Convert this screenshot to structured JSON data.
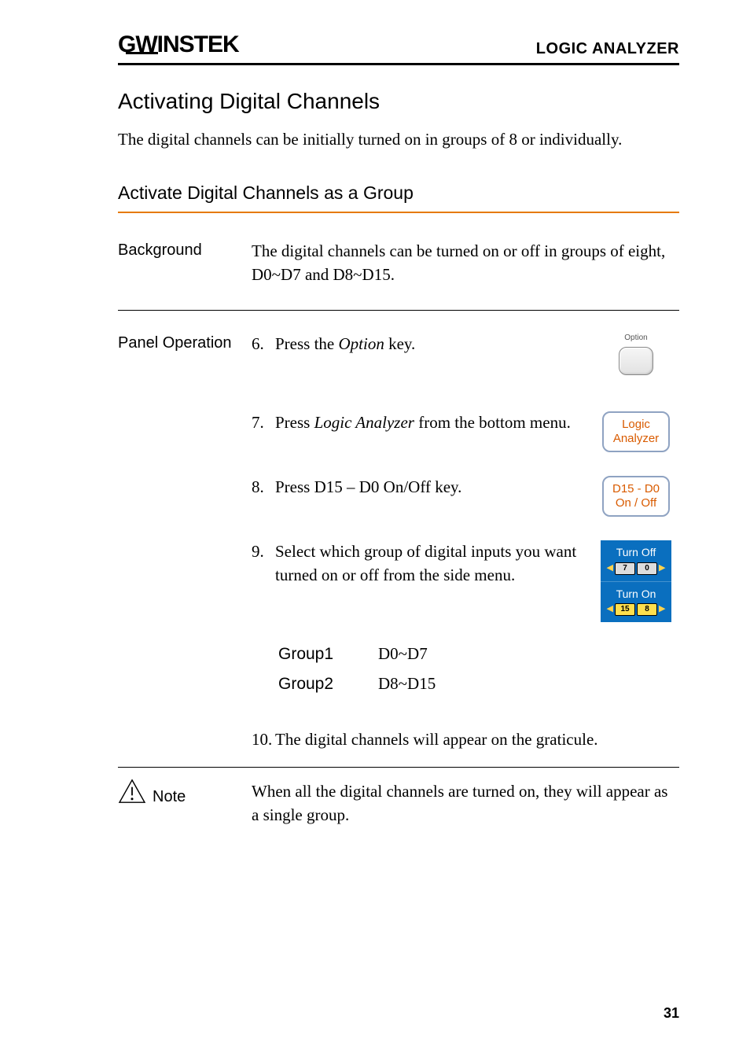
{
  "logo": "GWINSTEK",
  "header_category": "LOGIC ANALYZER",
  "h1": "Activating Digital Channels",
  "intro": "The digital channels can be initially turned on in groups of 8 or individually.",
  "h2": "Activate Digital Channels as a Group",
  "background_label": "Background",
  "background_text": "The digital channels can be turned on or off in groups of eight, D0~D7 and D8~D15.",
  "panelop_label": "Panel Operation",
  "step6": {
    "num": "6.",
    "pre": "Press the ",
    "em": "Option",
    "post": " key."
  },
  "option_key_label": "Option",
  "step7": {
    "num": "7.",
    "pre": "Press ",
    "em": "Logic Analyzer",
    "post": " from the bottom menu."
  },
  "btn_logic_l1": "Logic",
  "btn_logic_l2": "Analyzer",
  "step8": {
    "num": "8.",
    "text": "Press D15 – D0 On/Off key."
  },
  "btn_d15_l1": "D15 - D0",
  "btn_d15_l2": "On / Off",
  "step9": {
    "num": "9.",
    "text": "Select which group of digital inputs you want turned on or off from the side menu."
  },
  "side_turnoff": "Turn Off",
  "side_turnoff_chips": [
    "7",
    "0"
  ],
  "side_turnon": "Turn On",
  "side_turnon_chips": [
    "15",
    "8"
  ],
  "groups": [
    {
      "name": "Group1",
      "range": "D0~D7"
    },
    {
      "name": "Group2",
      "range": "D8~D15"
    }
  ],
  "step10": {
    "num": "10.",
    "text": "The digital channels will appear on the graticule."
  },
  "note_label": "Note",
  "note_text": "When all the digital channels are turned on, they will appear as a single group.",
  "page_num": "31"
}
